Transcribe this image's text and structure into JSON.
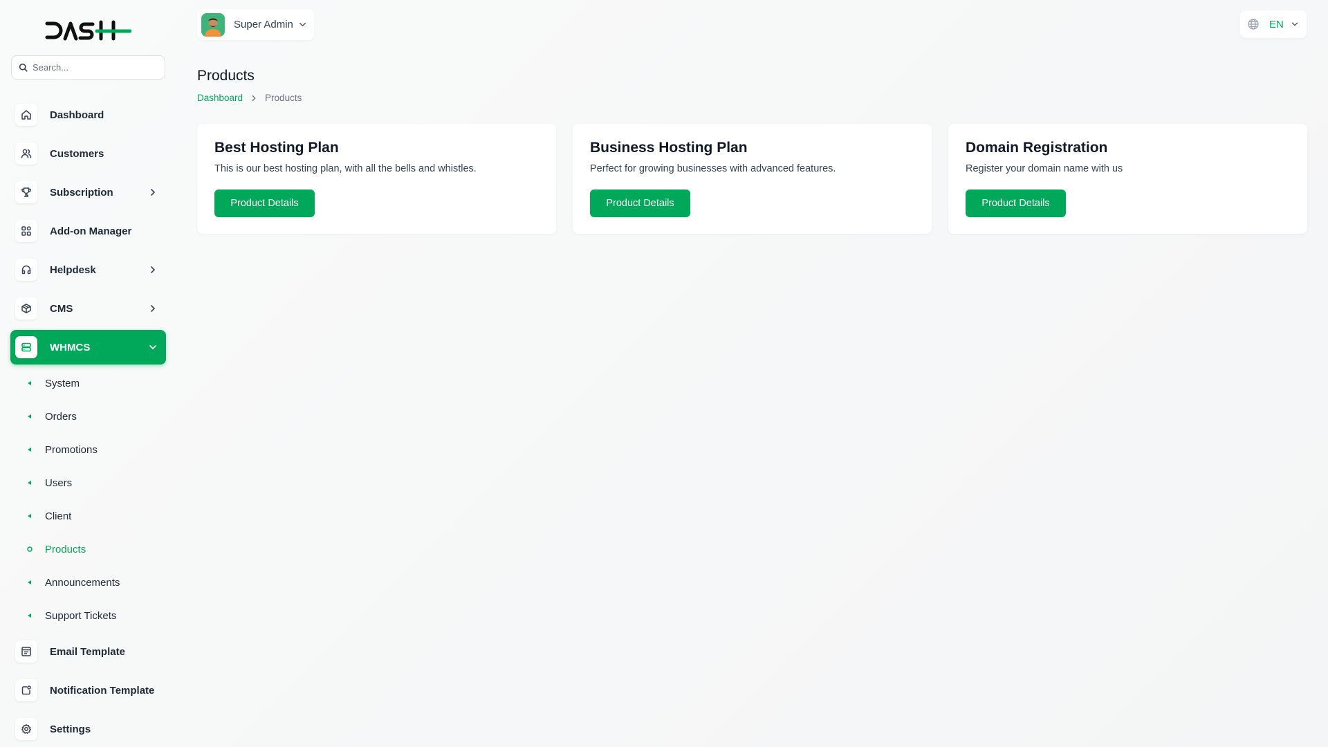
{
  "brand": {
    "accent": "#02a859"
  },
  "sidebar": {
    "search_placeholder": "Search...",
    "items": [
      {
        "label": "Dashboard",
        "icon": "home-icon"
      },
      {
        "label": "Customers",
        "icon": "users-icon"
      },
      {
        "label": "Subscription",
        "icon": "trophy-icon"
      },
      {
        "label": "Add-on Manager",
        "icon": "grid-icon"
      },
      {
        "label": "Helpdesk",
        "icon": "headphones-icon"
      },
      {
        "label": "CMS",
        "icon": "box-icon"
      },
      {
        "label": "WHMCS",
        "icon": "server-icon"
      }
    ],
    "whmcs_sub": [
      {
        "label": "System"
      },
      {
        "label": "Orders"
      },
      {
        "label": "Promotions"
      },
      {
        "label": "Users"
      },
      {
        "label": "Client"
      },
      {
        "label": "Products"
      },
      {
        "label": "Announcements"
      },
      {
        "label": "Support Tickets"
      }
    ],
    "bottom_items": [
      {
        "label": "Email Template",
        "icon": "template-icon"
      },
      {
        "label": "Notification Template",
        "icon": "notification-icon"
      },
      {
        "label": "Settings",
        "icon": "gear-icon"
      }
    ]
  },
  "header": {
    "user_name": "Super Admin",
    "language": "EN"
  },
  "page": {
    "title": "Products",
    "breadcrumb": {
      "home": "Dashboard",
      "current": "Products"
    }
  },
  "cards": [
    {
      "title": "Best Hosting Plan",
      "description": "This is our best hosting plan, with all the bells and whistles.",
      "button": "Product Details"
    },
    {
      "title": "Business Hosting Plan",
      "description": "Perfect for growing businesses with advanced features.",
      "button": "Product Details"
    },
    {
      "title": "Domain Registration",
      "description": "Register your domain name with us",
      "button": "Product Details"
    }
  ]
}
